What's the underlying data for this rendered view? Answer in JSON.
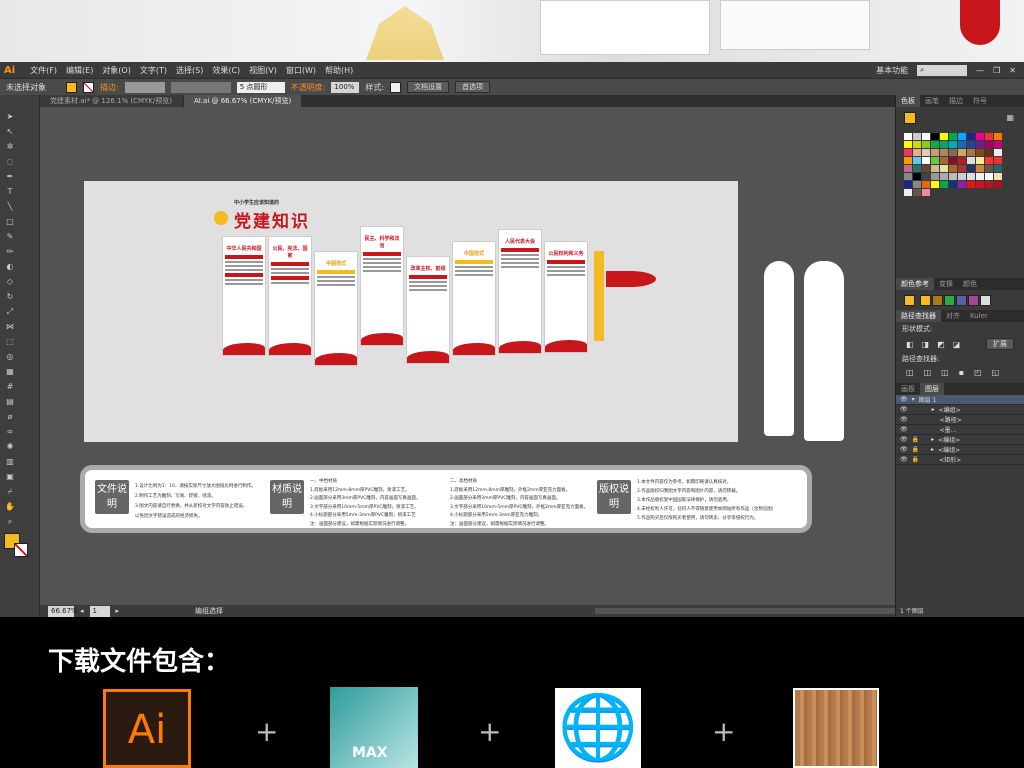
{
  "app": {
    "logo": "Ai",
    "menu": [
      "文件(F)",
      "编辑(E)",
      "对象(O)",
      "文字(T)",
      "选择(S)",
      "效果(C)",
      "视图(V)",
      "窗口(W)",
      "帮助(H)"
    ],
    "workspace": "基本功能"
  },
  "control": {
    "selection": "未选择对象",
    "stroke_label": "描边:",
    "brush": "5 点圆形",
    "opacity_label": "不透明度:",
    "opacity": "100%",
    "style_label": "样式:",
    "doc_setup": "文档设置",
    "prefs": "首选项"
  },
  "tabs": [
    {
      "label": "党建素材.ai* @ 126.1% (CMYK/预览)"
    },
    {
      "label": "AI.ai @ 66.67% (CMYK/预览)"
    }
  ],
  "artwork": {
    "subtitle": "中小学生应该知道的",
    "title": "党建知识",
    "panels": [
      "中华人民共和国",
      "公民、宪法、国家",
      "中国范式",
      "民主、科学和法治",
      "改革主权、前线",
      "中国范式",
      "人民代表大会",
      "公民权利和义务"
    ]
  },
  "info": {
    "file": {
      "badge": "文件说明",
      "lines": [
        "1.设计比例为1：10，请按实际尺寸放大图纸比例进行制作。",
        "2.制作工艺为雕刻、写真、焊接、喷漆。",
        "3.图文内容请自行更换，并从新校对文字内容防止错误，",
        "以免因文字错误造成的经济损失。"
      ]
    },
    "material": {
      "badge": "材质说明",
      "lines1": [
        "一、中档材质",
        "1.底板采用12mm-8mm厚PVC雕刻，喷漆工艺。",
        "2.画面部分采用3mm厚PVC雕刻，内容画面写真画面。",
        "3.文字部分采用10mm-5mm厚PVC雕刻，喷漆工艺。",
        "4.小标题部分采用5mm-3mm厚PVC雕刻，喷漆工艺",
        "注：画面部分建议，如需根据实际情况进行调整。"
      ],
      "lines2": [
        "二、高档材质",
        "1.底板采用12mm-8mm厚雕刻，外框2mm厚亚克力面板。",
        "2.画面部分采用3mm厚PVC雕刻，内容画面写真画面。",
        "3.文字部分采用10mm-5mm厚PVC雕刻，外框2mm厚亚克力面板。",
        "4.小标题部分采用5mm-3mm厚亚克力雕刻。",
        "注：画面部分建议，如需根据实际情况进行调整。"
      ]
    },
    "copyright": {
      "badge": "版权说明",
      "lines": [
        "1.本文件内容仅为参考，如需印刷请认真核对。",
        "2.作品版权归我图文字内容和图片内容，请勿转载。",
        "3.本作品版权受中国国家法律保护，请勿盗用。",
        "4.未经权利人许可，任何人不得随意使用本网站所有作品（含预览图）",
        "5.作品购买后仅限购买者使用，请勿转卖、分享等侵权行为。"
      ]
    }
  },
  "status": {
    "zoom": "66.67%",
    "page": "1",
    "mode": "编组选择"
  },
  "panels": {
    "swatch_tabs": [
      "色板",
      "画笔",
      "描边",
      "符号"
    ],
    "color_tabs": [
      "颜色参考",
      "变换",
      "颜色"
    ],
    "pathfinder_tabs": [
      "路径查找器",
      "对齐",
      "Kuler"
    ],
    "shape_modes": "形状模式:",
    "expand": "扩展",
    "pathfinder": "路径查找器:",
    "layer_tabs": [
      "图层",
      "画板"
    ],
    "layers": [
      "图层 1",
      "<编组>",
      "<路径>",
      "<墨...",
      "<编组>",
      "<编组>",
      "<矩形>"
    ],
    "layer_count": "1 个图层"
  },
  "bottom": {
    "title": "下载文件包含：",
    "icons": [
      {
        "name": "illustrator-icon",
        "label": "Ai"
      },
      {
        "name": "3dsmax-icon",
        "label": "MAX"
      },
      {
        "name": "globe-icon",
        "label": ""
      },
      {
        "name": "wood-texture-icon",
        "label": ""
      }
    ],
    "plus": "+"
  },
  "colors": {
    "accent": "#f7931e",
    "party_red": "#c8161d",
    "gold": "#f5b921"
  }
}
